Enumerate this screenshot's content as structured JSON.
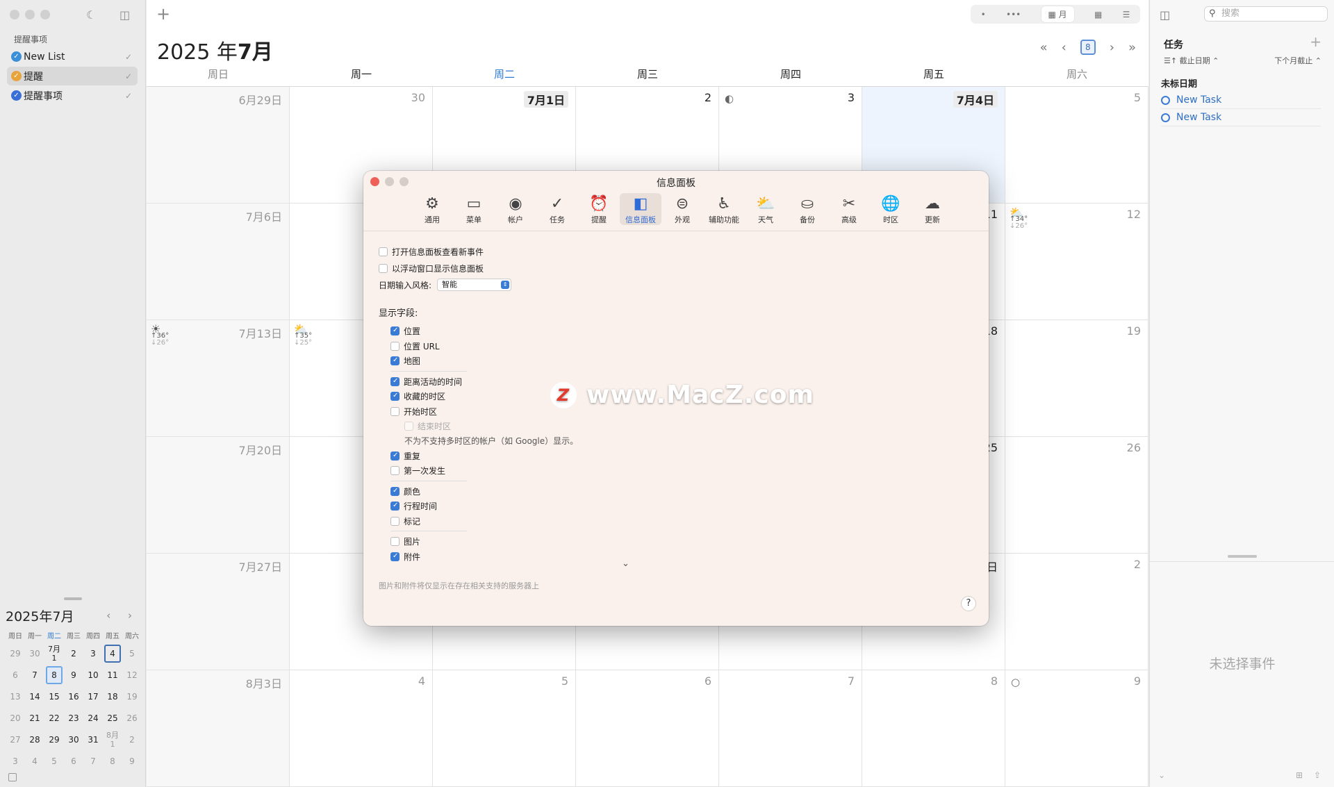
{
  "sidebar": {
    "section_title": "提醒事项",
    "lists": [
      {
        "label": "New List",
        "color": "#3a8fd8",
        "checked": true
      },
      {
        "label": "提醒",
        "color": "#e8a33b",
        "checked": true
      },
      {
        "label": "提醒事项",
        "color": "#3a6fd8",
        "checked": true
      }
    ],
    "mini_calendar": {
      "title": "2025年7月",
      "nav": "‹ ›",
      "weekdays": [
        "周日",
        "周一",
        "周二",
        "周三",
        "周四",
        "周五",
        "周六"
      ],
      "weeks": [
        [
          "29",
          "30",
          "7月\n1",
          "2",
          "3",
          "4",
          "5"
        ],
        [
          "6",
          "7",
          "8",
          "9",
          "10",
          "11",
          "12"
        ],
        [
          "13",
          "14",
          "15",
          "16",
          "17",
          "18",
          "19"
        ],
        [
          "20",
          "21",
          "22",
          "23",
          "24",
          "25",
          "26"
        ],
        [
          "27",
          "28",
          "29",
          "30",
          "31",
          "8月\n1",
          "2"
        ],
        [
          "3",
          "4",
          "5",
          "6",
          "7",
          "8",
          "9"
        ]
      ]
    }
  },
  "toolbar": {
    "add": "+",
    "view_options": [
      "•",
      "•••",
      "月",
      "▦",
      "☰"
    ],
    "active_view": "月"
  },
  "calendar": {
    "title_year": "2025 年",
    "title_month": "7月",
    "nav_today": "8",
    "weekdays": [
      "周日",
      "周一",
      "周二",
      "周三",
      "周四",
      "周五",
      "周六"
    ],
    "weeks": [
      [
        "6月29日",
        "30",
        "7月1日",
        "2",
        "3",
        "7月4日",
        "5"
      ],
      [
        "7月6日",
        "",
        "",
        "",
        "",
        "11",
        "12"
      ],
      [
        "7月13日",
        "",
        "",
        "",
        "",
        "18",
        "19"
      ],
      [
        "7月20日",
        "",
        "",
        "",
        "",
        "25",
        "26"
      ],
      [
        "7月27日",
        "",
        "",
        "",
        "",
        "日",
        "2"
      ],
      [
        "8月3日",
        "4",
        "5",
        "6",
        "7",
        "8",
        "9"
      ]
    ],
    "weather": {
      "jul11": {
        "hi": "↑34°",
        "lo": "↓26°"
      },
      "jul13": {
        "hi": "↑36°",
        "lo": "↓26°"
      },
      "jul14": {
        "hi": "↑35°",
        "lo": "↓25°"
      }
    }
  },
  "right_panel": {
    "search_placeholder": "搜索",
    "title": "任务",
    "add": "+",
    "sort_left": "截止日期 ⌃",
    "sort_right": "下个月截止 ⌃",
    "group": "未标日期",
    "tasks": [
      "New Task",
      "New Task"
    ],
    "no_selection": "未选择事件"
  },
  "dialog": {
    "title": "信息面板",
    "tabs": [
      {
        "label": "通用",
        "icon": "⚙"
      },
      {
        "label": "菜单",
        "icon": "▭"
      },
      {
        "label": "帐户",
        "icon": "◉"
      },
      {
        "label": "任务",
        "icon": "✓"
      },
      {
        "label": "提醒",
        "icon": "⏰"
      },
      {
        "label": "信息面板",
        "icon": "◧"
      },
      {
        "label": "外观",
        "icon": "⊜"
      },
      {
        "label": "辅助功能",
        "icon": "♿"
      },
      {
        "label": "天气",
        "icon": "⛅"
      },
      {
        "label": "备份",
        "icon": "⛀"
      },
      {
        "label": "高级",
        "icon": "✂"
      },
      {
        "label": "时区",
        "icon": "🌐"
      },
      {
        "label": "更新",
        "icon": "☁"
      }
    ],
    "active_tab": "信息面板",
    "open_panel": "打开信息面板查看新事件",
    "floating": "以浮动窗口显示信息面板",
    "date_style_label": "日期输入风格:",
    "date_style_value": "智能",
    "fields_label": "显示字段:",
    "fields": [
      {
        "label": "位置",
        "on": true
      },
      {
        "label": "位置 URL",
        "on": false
      },
      {
        "label": "地图",
        "on": true
      },
      {
        "sep": true
      },
      {
        "label": "距离活动的时间",
        "on": true
      },
      {
        "label": "收藏的时区",
        "on": true
      },
      {
        "label": "开始时区",
        "on": false
      },
      {
        "label": "结束时区",
        "on": false,
        "disabled": true,
        "indent": true
      },
      {
        "note": "不为不支持多时区的帐户（如 Google）显示。"
      },
      {
        "label": "重复",
        "on": true
      },
      {
        "label": "第一次发生",
        "on": false
      },
      {
        "sep": true
      },
      {
        "label": "颜色",
        "on": true
      },
      {
        "label": "行程时间",
        "on": true
      },
      {
        "label": "标记",
        "on": false
      },
      {
        "sep": true
      },
      {
        "label": "图片",
        "on": false
      },
      {
        "label": "附件",
        "on": true
      }
    ],
    "more": "⌄",
    "footer_note": "图片和附件将仅显示在存在相关支持的服务器上",
    "help": "?"
  },
  "watermark": {
    "logo": "Z",
    "text": "www.MacZ.com"
  }
}
